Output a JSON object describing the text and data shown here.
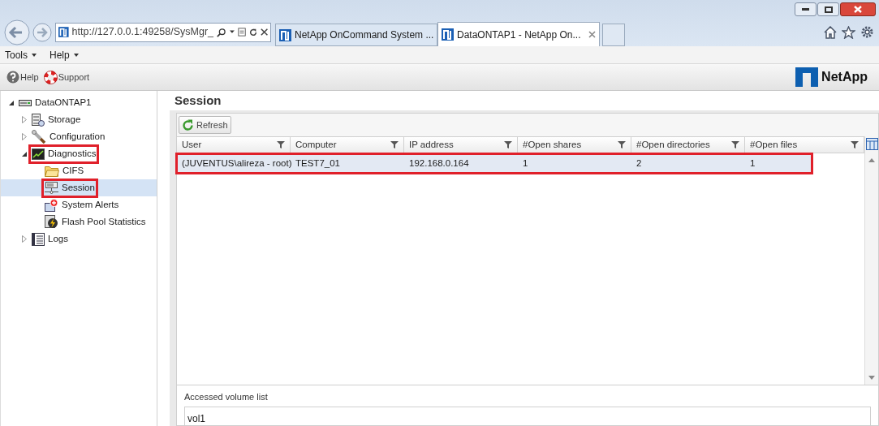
{
  "browser": {
    "address": "http://127.0.0.1:49258/SysMgr_",
    "tabs": [
      {
        "label": "NetApp OnCommand System ...",
        "selected": false
      },
      {
        "label": "DataONTAP1 - NetApp On...",
        "selected": true
      }
    ]
  },
  "menu": [
    "Tools",
    "Help"
  ],
  "toolbar": [
    "Help",
    "Support"
  ],
  "logo": "NetApp",
  "tree": {
    "label": "DataONTAP1",
    "kind": "system",
    "expanded": true,
    "selected": false,
    "annotated": false,
    "children": [
      {
        "label": "Storage",
        "kind": "storage",
        "expanded": false,
        "selected": false,
        "annotated": false
      },
      {
        "label": "Configuration",
        "kind": "wrench",
        "expanded": false,
        "selected": false,
        "annotated": false
      },
      {
        "label": "Diagnostics",
        "kind": "monitor",
        "expanded": true,
        "selected": false,
        "annotated": true,
        "children": [
          {
            "label": "CIFS",
            "kind": "folder",
            "selected": false,
            "annotated": false
          },
          {
            "label": "Session",
            "kind": "session",
            "selected": true,
            "annotated": true
          },
          {
            "label": "System Alerts",
            "kind": "alert",
            "selected": false,
            "annotated": false
          },
          {
            "label": "Flash Pool Statistics",
            "kind": "flash",
            "selected": false,
            "annotated": false
          }
        ]
      },
      {
        "label": "Logs",
        "kind": "logs",
        "expanded": false,
        "selected": false,
        "annotated": false
      }
    ]
  },
  "page_title": "Session",
  "refresh": "Refresh",
  "table": {
    "columns": [
      "User",
      "Computer",
      "IP address",
      "#Open shares",
      "#Open directories",
      "#Open files"
    ],
    "rows": [
      {
        "cells": [
          "(JUVENTUS\\alireza - root)",
          "TEST7_01",
          "192.168.0.164",
          "1",
          "2",
          "1"
        ],
        "selected": true,
        "annotated": true
      }
    ]
  },
  "detail": {
    "label": "Accessed volume list",
    "value": "vol1"
  }
}
